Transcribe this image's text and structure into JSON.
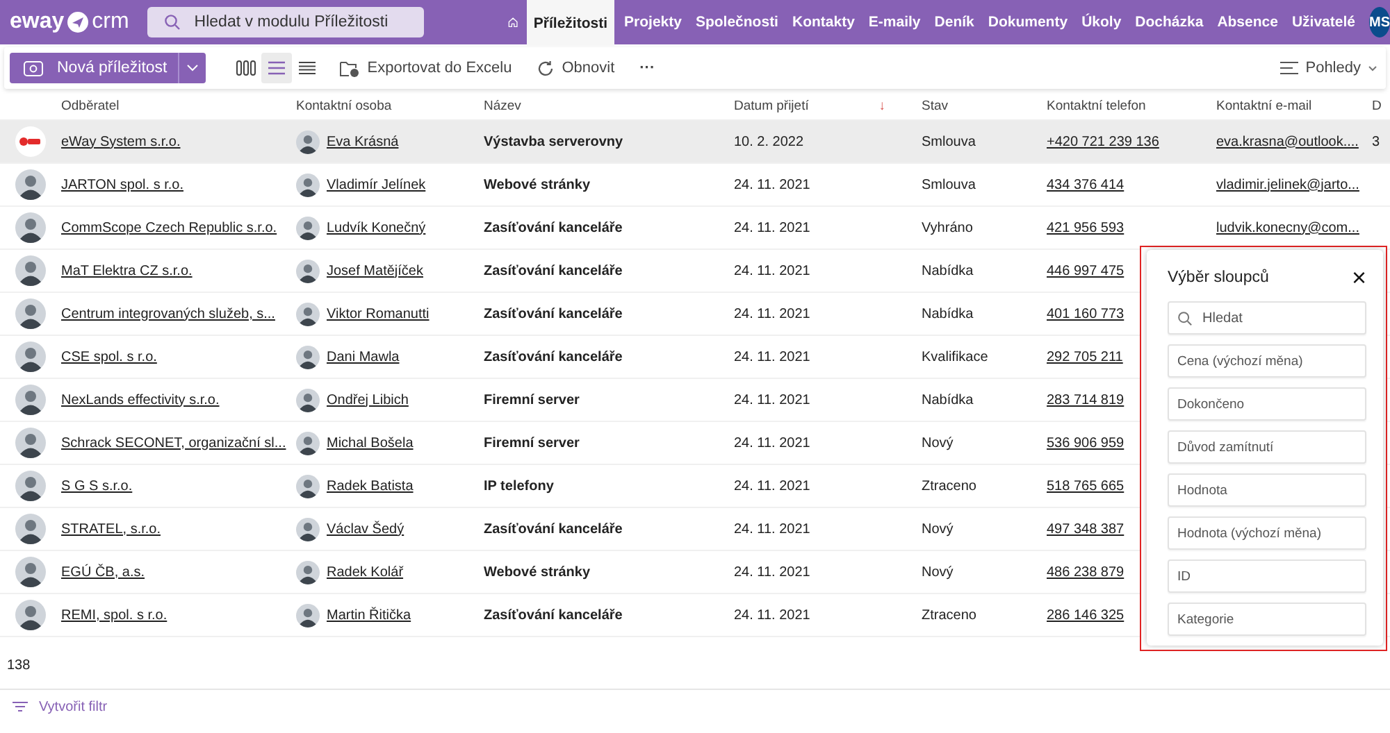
{
  "header": {
    "logo": "eway",
    "logo_suffix": "crm",
    "search": {
      "placeholder": "Hledat v modulu Příležitosti"
    },
    "nav": [
      {
        "label": "Příležitosti",
        "selected": true
      },
      {
        "label": "Projekty",
        "selected": false
      },
      {
        "label": "Společnosti",
        "selected": false
      },
      {
        "label": "Kontakty",
        "selected": false
      },
      {
        "label": "E-maily",
        "selected": false
      },
      {
        "label": "Deník",
        "selected": false
      },
      {
        "label": "Dokumenty",
        "selected": false
      },
      {
        "label": "Úkoly",
        "selected": false
      },
      {
        "label": "Docházka",
        "selected": false
      },
      {
        "label": "Absence",
        "selected": false
      },
      {
        "label": "Uživatelé",
        "selected": false
      }
    ],
    "user_initials": "MS"
  },
  "toolbar": {
    "new_button": "Nová příležitost",
    "views": [
      {
        "kind": "columns",
        "selected": false
      },
      {
        "kind": "list",
        "selected": true
      },
      {
        "kind": "compact",
        "selected": false
      }
    ],
    "export": "Exportovat do Excelu",
    "refresh": "Obnovit",
    "more": "···",
    "views_menu": "Pohledy"
  },
  "table": {
    "columns": [
      "Odběratel",
      "Kontaktní osoba",
      "Název",
      "Datum přijetí",
      "Stav",
      "Kontaktní telefon",
      "Kontaktní e-mail",
      "D"
    ],
    "sort_arrow": "↓",
    "rows": [
      {
        "selected": true,
        "kind": "company",
        "company": "eWay System s.r.o.",
        "contact": "Eva Krásná",
        "name": "Výstavba serverovny",
        "date": "10. 2. 2022",
        "status": "Smlouva",
        "phone": "+420 721 239 136",
        "email": "eva.krasna@outlook....",
        "column_9": "3"
      },
      {
        "selected": false,
        "kind": "person",
        "company": "JARTON spol. s r.o.",
        "contact": "Vladimír Jelínek",
        "name": "Webové stránky",
        "date": "24. 11. 2021",
        "status": "Smlouva",
        "phone": "434 376 414",
        "email": "vladimir.jelinek@jarto..."
      },
      {
        "selected": false,
        "kind": "person",
        "company": "CommScope Czech Republic s.r.o.",
        "contact": "Ludvík Konečný",
        "name": "Zasíťování kanceláře",
        "date": "24. 11. 2021",
        "status": "Vyhráno",
        "phone": "421 956 593",
        "email": "ludvik.konecny@com..."
      },
      {
        "selected": false,
        "kind": "person",
        "company": "MaT Elektra CZ s.r.o.",
        "contact": "Josef Matějíček",
        "name": "Zasíťování kanceláře",
        "date": "24. 11. 2021",
        "status": "Nabídka",
        "phone": "446 997 475"
      },
      {
        "selected": false,
        "kind": "person",
        "company": "Centrum integrovaných služeb, s...",
        "contact": "Viktor Romanutti",
        "name": "Zasíťování kanceláře",
        "date": "24. 11. 2021",
        "status": "Nabídka",
        "phone": "401 160 773"
      },
      {
        "selected": false,
        "kind": "person",
        "company": "CSE spol. s r.o.",
        "contact": "Dani Mawla",
        "name": "Zasíťování kanceláře",
        "date": "24. 11. 2021",
        "status": "Kvalifikace",
        "phone": "292 705 211"
      },
      {
        "selected": false,
        "kind": "person",
        "company": "NexLands effectivity s.r.o.",
        "contact": "Ondřej Libich",
        "name": "Firemní server",
        "date": "24. 11. 2021",
        "status": "Nabídka",
        "phone": "283 714 819"
      },
      {
        "selected": false,
        "kind": "person",
        "company": "Schrack SECONET, organizační sl...",
        "contact": "Michal Bošela",
        "name": "Firemní server",
        "date": "24. 11. 2021",
        "status": "Nový",
        "phone": "536 906 959"
      },
      {
        "selected": false,
        "kind": "person",
        "company": "S G S s.r.o.",
        "contact": "Radek Batista",
        "name": "IP telefony",
        "date": "24. 11. 2021",
        "status": "Ztraceno",
        "phone": "518 765 665"
      },
      {
        "selected": false,
        "kind": "person",
        "company": "STRATEL, s.r.o.",
        "contact": "Václav Šedý",
        "name": "Zasíťování kanceláře",
        "date": "24. 11. 2021",
        "status": "Nový",
        "phone": "497 348 387"
      },
      {
        "selected": false,
        "kind": "person",
        "company": "EGÚ ČB, a.s.",
        "contact": "Radek Kolář",
        "name": "Webové stránky",
        "date": "24. 11. 2021",
        "status": "Nový",
        "phone": "486 238 879"
      },
      {
        "selected": false,
        "kind": "person",
        "company": "REMI, spol. s r.o.",
        "contact": "Martin Řitička",
        "name": "Zasíťování kanceláře",
        "date": "24. 11. 2021",
        "status": "Ztraceno",
        "phone": "286 146 325"
      }
    ],
    "count": "138"
  },
  "filter_button": "Vytvořit filtr",
  "column_picker": {
    "title": "Výběr sloupců",
    "close": "×",
    "search": {
      "placeholder": "Hledat"
    },
    "items": [
      "Cena (výchozí měna)",
      "Dokončeno",
      "Důvod zamítnutí",
      "Hodnota",
      "Hodnota (výchozí měna)",
      "ID",
      "Kategorie"
    ]
  }
}
